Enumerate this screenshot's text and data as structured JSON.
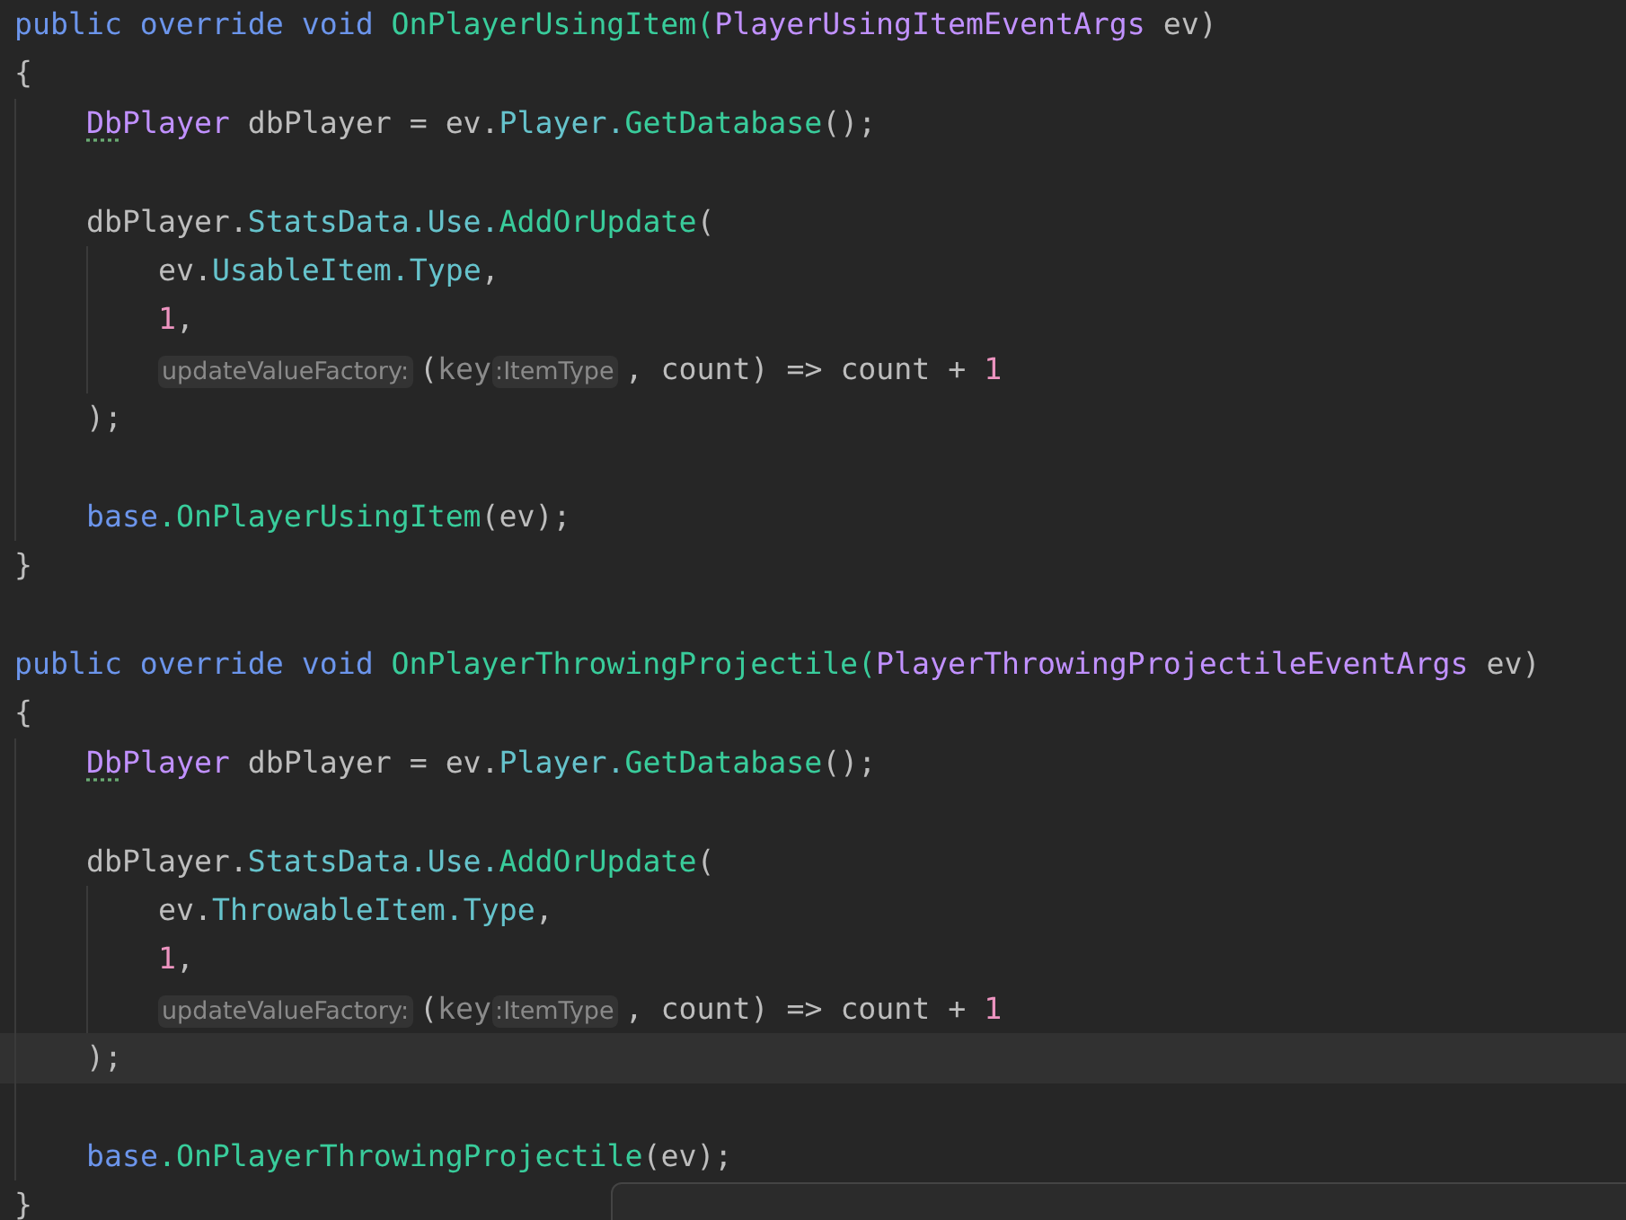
{
  "editor": {
    "lines": [
      {
        "kind": "top",
        "tokens": [
          {
            "kind": "keyword",
            "text": "public override void"
          },
          {
            "kind": "method",
            "text": " OnPlayerUsingItem("
          },
          {
            "kind": "type",
            "text": "PlayerUsingItemEventArgs"
          },
          {
            "kind": "plain",
            "text": " ev)"
          }
        ]
      },
      {
        "kind": "top",
        "tokens": [
          {
            "kind": "plain",
            "text": "{"
          }
        ]
      },
      {
        "kind": "body",
        "tokens": [
          {
            "kind": "type_warn",
            "text": "Db"
          },
          {
            "kind": "type",
            "text": "Player"
          },
          {
            "kind": "plain",
            "text": " dbPlayer = ev."
          },
          {
            "kind": "property",
            "text": "Player."
          },
          {
            "kind": "method",
            "text": "GetDatabase"
          },
          {
            "kind": "plain",
            "text": "();"
          }
        ]
      },
      {
        "kind": "blank"
      },
      {
        "kind": "body",
        "tokens": [
          {
            "kind": "plain",
            "text": "dbPlayer."
          },
          {
            "kind": "property",
            "text": "StatsData.Use."
          },
          {
            "kind": "method",
            "text": "AddOrUpdate"
          },
          {
            "kind": "plain",
            "text": "("
          }
        ]
      },
      {
        "kind": "arg",
        "tokens": [
          {
            "kind": "plain",
            "text": "ev."
          },
          {
            "kind": "property",
            "text": "UsableItem.Type"
          },
          {
            "kind": "plain",
            "text": ","
          }
        ]
      },
      {
        "kind": "arg",
        "tokens": [
          {
            "kind": "number",
            "text": "1"
          },
          {
            "kind": "plain",
            "text": ","
          }
        ]
      },
      {
        "kind": "arg",
        "tokens": [
          {
            "kind": "hint",
            "text": "updateValueFactory:"
          },
          {
            "kind": "plain",
            "text": "("
          },
          {
            "kind": "param_dim",
            "text": "key"
          },
          {
            "kind": "hint",
            "text": ":ItemType"
          },
          {
            "kind": "plain",
            "text": ", count) => count +"
          },
          {
            "kind": "number",
            "text": " 1"
          }
        ]
      },
      {
        "kind": "body",
        "tokens": [
          {
            "kind": "plain",
            "text": ");"
          }
        ]
      },
      {
        "kind": "blank"
      },
      {
        "kind": "body",
        "tokens": [
          {
            "kind": "keyword",
            "text": "base"
          },
          {
            "kind": "method",
            "text": ".OnPlayerUsingItem"
          },
          {
            "kind": "plain",
            "text": "(ev);"
          }
        ]
      },
      {
        "kind": "top",
        "tokens": [
          {
            "kind": "plain",
            "text": "}"
          }
        ]
      },
      {
        "kind": "blank"
      },
      {
        "kind": "top",
        "tokens": [
          {
            "kind": "keyword",
            "text": "public override void"
          },
          {
            "kind": "method",
            "text": " OnPlayerThrowingProjectile("
          },
          {
            "kind": "type",
            "text": "PlayerThrowingProjectileEventArgs"
          },
          {
            "kind": "plain",
            "text": " ev)"
          }
        ]
      },
      {
        "kind": "top",
        "tokens": [
          {
            "kind": "plain",
            "text": "{"
          }
        ]
      },
      {
        "kind": "body",
        "tokens": [
          {
            "kind": "type_warn",
            "text": "Db"
          },
          {
            "kind": "type",
            "text": "Player"
          },
          {
            "kind": "plain",
            "text": " dbPlayer = ev."
          },
          {
            "kind": "property",
            "text": "Player."
          },
          {
            "kind": "method",
            "text": "GetDatabase"
          },
          {
            "kind": "plain",
            "text": "();"
          }
        ]
      },
      {
        "kind": "blank"
      },
      {
        "kind": "body",
        "tokens": [
          {
            "kind": "plain",
            "text": "dbPlayer."
          },
          {
            "kind": "property",
            "text": "StatsData.Use."
          },
          {
            "kind": "method",
            "text": "AddOrUpdate"
          },
          {
            "kind": "plain",
            "text": "("
          }
        ]
      },
      {
        "kind": "arg",
        "tokens": [
          {
            "kind": "plain",
            "text": "ev."
          },
          {
            "kind": "property",
            "text": "ThrowableItem.Type"
          },
          {
            "kind": "plain",
            "text": ","
          }
        ]
      },
      {
        "kind": "arg",
        "tokens": [
          {
            "kind": "number",
            "text": "1"
          },
          {
            "kind": "plain",
            "text": ","
          }
        ]
      },
      {
        "kind": "arg",
        "tokens": [
          {
            "kind": "hint",
            "text": "updateValueFactory:"
          },
          {
            "kind": "plain",
            "text": "("
          },
          {
            "kind": "param_dim",
            "text": "key"
          },
          {
            "kind": "hint",
            "text": ":ItemType"
          },
          {
            "kind": "plain",
            "text": ", count) => count +"
          },
          {
            "kind": "number",
            "text": " 1"
          }
        ]
      },
      {
        "kind": "current",
        "tokens": [
          {
            "kind": "plain",
            "text": ");"
          }
        ]
      },
      {
        "kind": "blank"
      },
      {
        "kind": "body",
        "tokens": [
          {
            "kind": "keyword",
            "text": "base"
          },
          {
            "kind": "method",
            "text": ".OnPlayerThrowingProjectile"
          },
          {
            "kind": "plain",
            "text": "(ev);"
          }
        ]
      },
      {
        "kind": "top",
        "tokens": [
          {
            "kind": "plain",
            "text": "}"
          }
        ]
      }
    ]
  },
  "popup": {
    "kind": "panel"
  }
}
